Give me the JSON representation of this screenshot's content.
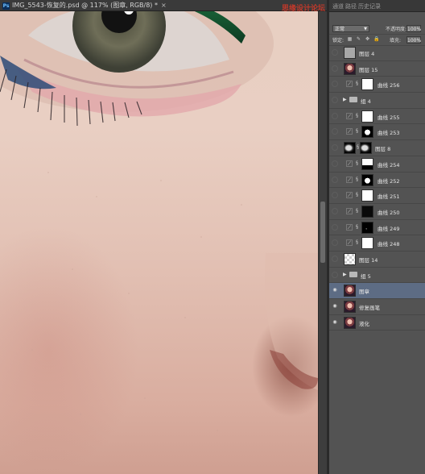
{
  "document": {
    "title": "IMG_5543-恢复的.psd @ 117% (图章, RGB/8) *",
    "app_badge": "Ps",
    "close_glyph": "×"
  },
  "watermark": {
    "primary": "思缘设计论坛",
    "secondary": "www.MISSYUAN.COM"
  },
  "panel": {
    "tabs": [
      "通道",
      "路径",
      "历史记录"
    ],
    "blend_mode": "正常",
    "opacity_label": "不透明度:",
    "opacity_value": "100%",
    "lock_label": "锁定:",
    "fill_label": "填充:",
    "fill_value": "100%"
  },
  "layers": [
    {
      "name": "图层 4",
      "visible": false,
      "thumb": "gray"
    },
    {
      "name": "图层 15",
      "visible": false,
      "thumb": "face"
    },
    {
      "name": "曲线 256",
      "visible": false,
      "adjustment": true,
      "mask": "white"
    },
    {
      "name": "组 4",
      "visible": false,
      "group": true
    },
    {
      "name": "曲线 255",
      "visible": false,
      "adjustment": true,
      "mask": "white"
    },
    {
      "name": "曲线 253",
      "visible": false,
      "adjustment": true,
      "mask": "blot-w"
    },
    {
      "name": "图层 8",
      "visible": false,
      "thumb": "blob",
      "mask": "blob"
    },
    {
      "name": "曲线 254",
      "visible": false,
      "adjustment": true,
      "mask": "white-bot"
    },
    {
      "name": "曲线 252",
      "visible": false,
      "adjustment": true,
      "mask": "blot-w"
    },
    {
      "name": "曲线 251",
      "visible": false,
      "adjustment": true,
      "mask": "white"
    },
    {
      "name": "曲线 250",
      "visible": false,
      "adjustment": true,
      "mask": "black"
    },
    {
      "name": "曲线 249",
      "visible": false,
      "adjustment": true,
      "mask": "blot-b"
    },
    {
      "name": "曲线 248",
      "visible": false,
      "adjustment": true,
      "mask": "white"
    },
    {
      "name": "图层 14",
      "visible": false,
      "thumb": "check"
    },
    {
      "name": "组 5",
      "visible": false,
      "group": true
    },
    {
      "name": "图章",
      "visible": true,
      "thumb": "face",
      "selected": true
    },
    {
      "name": "修复画笔",
      "visible": true,
      "thumb": "face"
    },
    {
      "name": "液化",
      "visible": true,
      "thumb": "face"
    },
    {
      "name": "背景",
      "visible": true,
      "thumb": "face",
      "italic": true,
      "locked": true
    }
  ],
  "icons": {
    "eye": "eye-icon",
    "folder": "folder-icon",
    "adjustment": "curves-adjustment-icon",
    "chain": "link-icon",
    "lock": "lock-icon"
  }
}
